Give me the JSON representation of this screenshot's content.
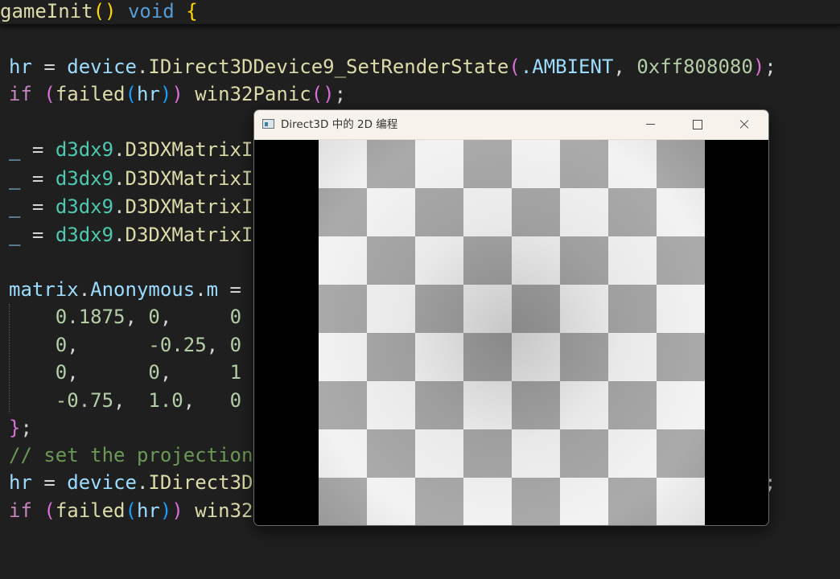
{
  "editor": {
    "lines": [
      [
        {
          "t": "gameInit",
          "c": "fn"
        },
        {
          "t": "()",
          "c": "p1"
        },
        {
          "t": " void ",
          "c": "kw"
        },
        {
          "t": "{",
          "c": "p1"
        }
      ],
      [
        {
          "t": "hr",
          "c": "var"
        },
        {
          "t": " = ",
          "c": "plain"
        },
        {
          "t": "device",
          "c": "var"
        },
        {
          "t": ".",
          "c": "plain"
        },
        {
          "t": "IDirect3DDevice9_SetRenderState",
          "c": "fn"
        },
        {
          "t": "(",
          "c": "p2"
        },
        {
          "t": ".AMBIENT",
          "c": "var"
        },
        {
          "t": ", ",
          "c": "plain"
        },
        {
          "t": "0xff808080",
          "c": "num"
        },
        {
          "t": ")",
          "c": "p2"
        },
        {
          "t": ";",
          "c": "plain"
        }
      ],
      [
        {
          "t": "if",
          "c": "ctl"
        },
        {
          "t": " ",
          "c": "plain"
        },
        {
          "t": "(",
          "c": "p2"
        },
        {
          "t": "failed",
          "c": "fn"
        },
        {
          "t": "(",
          "c": "p3"
        },
        {
          "t": "hr",
          "c": "var"
        },
        {
          "t": ")",
          "c": "p3"
        },
        {
          "t": ")",
          "c": "p2"
        },
        {
          "t": " ",
          "c": "plain"
        },
        {
          "t": "win32Panic",
          "c": "fn"
        },
        {
          "t": "()",
          "c": "p2"
        },
        {
          "t": ";",
          "c": "plain"
        }
      ],
      [
        {
          "t": "_",
          "c": "var"
        },
        {
          "t": " = ",
          "c": "plain"
        },
        {
          "t": "d3dx9",
          "c": "typ"
        },
        {
          "t": ".",
          "c": "plain"
        },
        {
          "t": "D3DXMatrixI",
          "c": "fn"
        }
      ],
      [
        {
          "t": "_",
          "c": "var"
        },
        {
          "t": " = ",
          "c": "plain"
        },
        {
          "t": "d3dx9",
          "c": "typ"
        },
        {
          "t": ".",
          "c": "plain"
        },
        {
          "t": "D3DXMatrixI",
          "c": "fn"
        }
      ],
      [
        {
          "t": "_",
          "c": "var"
        },
        {
          "t": " = ",
          "c": "plain"
        },
        {
          "t": "d3dx9",
          "c": "typ"
        },
        {
          "t": ".",
          "c": "plain"
        },
        {
          "t": "D3DXMatrixI",
          "c": "fn"
        }
      ],
      [
        {
          "t": "_",
          "c": "var"
        },
        {
          "t": " = ",
          "c": "plain"
        },
        {
          "t": "d3dx9",
          "c": "typ"
        },
        {
          "t": ".",
          "c": "plain"
        },
        {
          "t": "D3DXMatrixI",
          "c": "fn"
        }
      ],
      [
        {
          "t": "matrix",
          "c": "var"
        },
        {
          "t": ".",
          "c": "plain"
        },
        {
          "t": "Anonymous",
          "c": "var"
        },
        {
          "t": ".",
          "c": "plain"
        },
        {
          "t": "m",
          "c": "var"
        },
        {
          "t": " =",
          "c": "plain"
        }
      ],
      [
        {
          "t": "    ",
          "c": "plain"
        },
        {
          "t": "0.1875",
          "c": "num"
        },
        {
          "t": ", ",
          "c": "plain"
        },
        {
          "t": "0",
          "c": "num"
        },
        {
          "t": ",     ",
          "c": "plain"
        },
        {
          "t": "0",
          "c": "num"
        }
      ],
      [
        {
          "t": "    ",
          "c": "plain"
        },
        {
          "t": "0",
          "c": "num"
        },
        {
          "t": ",      ",
          "c": "plain"
        },
        {
          "t": "-0.25",
          "c": "num"
        },
        {
          "t": ", ",
          "c": "plain"
        },
        {
          "t": "0",
          "c": "num"
        }
      ],
      [
        {
          "t": "    ",
          "c": "plain"
        },
        {
          "t": "0",
          "c": "num"
        },
        {
          "t": ",      ",
          "c": "plain"
        },
        {
          "t": "0",
          "c": "num"
        },
        {
          "t": ",     ",
          "c": "plain"
        },
        {
          "t": "1",
          "c": "num"
        }
      ],
      [
        {
          "t": "    ",
          "c": "plain"
        },
        {
          "t": "-0.75",
          "c": "num"
        },
        {
          "t": ",  ",
          "c": "plain"
        },
        {
          "t": "1.0",
          "c": "num"
        },
        {
          "t": ",   ",
          "c": "plain"
        },
        {
          "t": "0",
          "c": "num"
        }
      ],
      [
        {
          "t": "}",
          "c": "p2"
        },
        {
          "t": ";",
          "c": "plain"
        }
      ],
      [
        {
          "t": "// set the projection",
          "c": "cmt"
        }
      ],
      [
        {
          "t": "hr",
          "c": "var"
        },
        {
          "t": " = ",
          "c": "plain"
        },
        {
          "t": "device",
          "c": "var"
        },
        {
          "t": ".",
          "c": "plain"
        },
        {
          "t": "IDirect3D",
          "c": "fn"
        }
      ],
      [
        {
          "t": "if",
          "c": "ctl"
        },
        {
          "t": " ",
          "c": "plain"
        },
        {
          "t": "(",
          "c": "p2"
        },
        {
          "t": "failed",
          "c": "fn"
        },
        {
          "t": "(",
          "c": "p3"
        },
        {
          "t": "hr",
          "c": "var"
        },
        {
          "t": ")",
          "c": "p3"
        },
        {
          "t": ")",
          "c": "p2"
        },
        {
          "t": " ",
          "c": "plain"
        },
        {
          "t": "win32",
          "c": "fn"
        }
      ]
    ],
    "trailing_semicolon": ";"
  },
  "window": {
    "title": "Direct3D 中的 2D 编程",
    "icon": "app-window-icon",
    "minimize_icon": "minimize-icon",
    "maximize_icon": "maximize-icon",
    "close_icon": "close-icon"
  },
  "checkerboard": {
    "rows": 8,
    "cols": 8,
    "light_color": "#f2f2f2",
    "dark_color": "#a6a6a6",
    "background": "#000000"
  }
}
